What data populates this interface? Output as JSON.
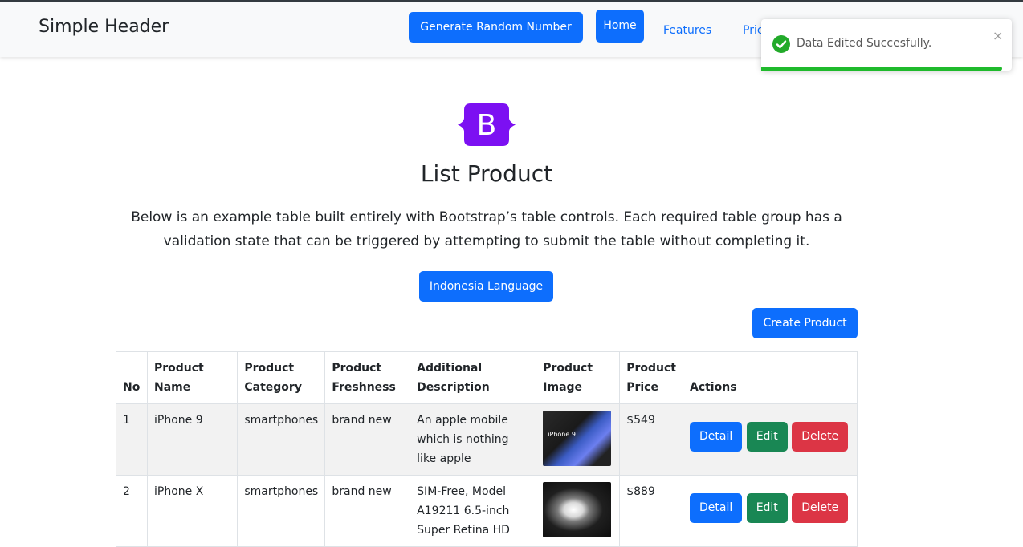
{
  "navbar": {
    "brand": "Simple Header",
    "generate_label": "Generate Random Number",
    "home_label": "Home",
    "links": [
      "Features",
      "Pricing"
    ]
  },
  "toast": {
    "message": "Data Edited Succesfully.",
    "close": "×",
    "progress": 0.96
  },
  "logo": {
    "letter": "B",
    "color": "#7c10f2"
  },
  "main": {
    "title": "List Product",
    "description": "Below is an example table built entirely with Bootstrap’s table controls. Each required table group has a validation state that can be triggered by attempting to submit the table without completing it.",
    "language_button": "Indonesia Language",
    "create_button": "Create Product"
  },
  "table": {
    "headers": [
      "No",
      "Product Name",
      "Product Category",
      "Product Freshness",
      "Additional Description",
      "Product Image",
      "Product Price",
      "Actions"
    ],
    "rows": [
      {
        "no": "1",
        "name": "iPhone 9",
        "category": "smartphones",
        "freshness": "brand new",
        "description": "An apple mobile which is nothing like apple",
        "image_label": "iPhone 9",
        "price": "$549"
      },
      {
        "no": "2",
        "name": "iPhone X",
        "category": "smartphones",
        "freshness": "brand new",
        "description": "SIM-Free, Model A19211 6.5-inch Super Retina HD",
        "price": "$889"
      }
    ],
    "actions": {
      "detail": "Detail",
      "edit": "Edit",
      "delete": "Delete"
    }
  },
  "colors": {
    "primary": "#0d6efd",
    "success": "#198754",
    "danger": "#dc3545",
    "toast_green": "#1fba2c"
  }
}
